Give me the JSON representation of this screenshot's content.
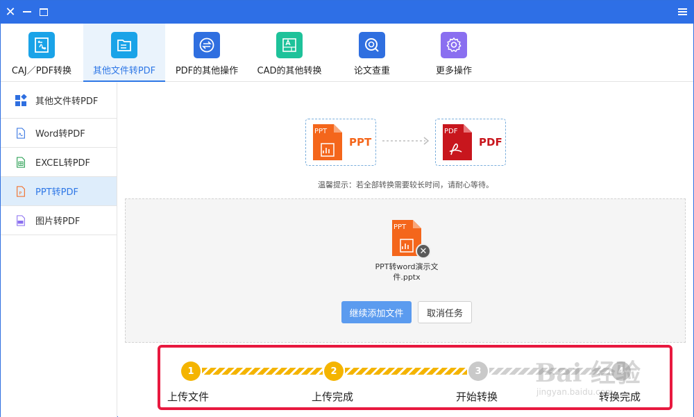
{
  "titlebar": {
    "close": "✕"
  },
  "toolbar": {
    "items": [
      {
        "label": "CAJ／PDF转换",
        "color": "#1aa3e8"
      },
      {
        "label": "其他文件转PDF",
        "color": "#1aa3e8"
      },
      {
        "label": "PDF的其他操作",
        "color": "#2f6fe0"
      },
      {
        "label": "CAD的其他转换",
        "color": "#1ec29a"
      },
      {
        "label": "论文查重",
        "color": "#2f6fe0"
      },
      {
        "label": "更多操作",
        "color": "#8a6ff0"
      }
    ]
  },
  "sidebar": {
    "items": [
      {
        "label": "其他文件转PDF"
      },
      {
        "label": "Word转PDF"
      },
      {
        "label": "EXCEL转PDF"
      },
      {
        "label": "PPT转PDF"
      },
      {
        "label": "图片转PDF"
      }
    ]
  },
  "conversion": {
    "from_label": "PPT",
    "from_icon_text": "PPT",
    "to_label": "PDF",
    "to_icon_text": "PDF",
    "tip": "温馨提示：若全部转换需要较长时间，请耐心等待。"
  },
  "file": {
    "icon_text": "PPT",
    "name": "PPT转word演示文件.pptx"
  },
  "buttons": {
    "add": "继续添加文件",
    "cancel": "取消任务"
  },
  "steps": {
    "items": [
      {
        "num": "1",
        "label": "上传文件",
        "state": "done"
      },
      {
        "num": "2",
        "label": "上传完成",
        "state": "done"
      },
      {
        "num": "3",
        "label": "开始转换",
        "state": "todo"
      },
      {
        "num": "4",
        "label": "转换完成",
        "state": "todo"
      }
    ]
  },
  "colors": {
    "accent": "#2e77e6",
    "ppt": "#f4661b",
    "pdf": "#c8161d",
    "step_done": "#f4b400",
    "highlight_border": "#e8193f"
  },
  "watermark": {
    "main": "Bai 经验",
    "sub": "jingyan.baidu.com"
  }
}
